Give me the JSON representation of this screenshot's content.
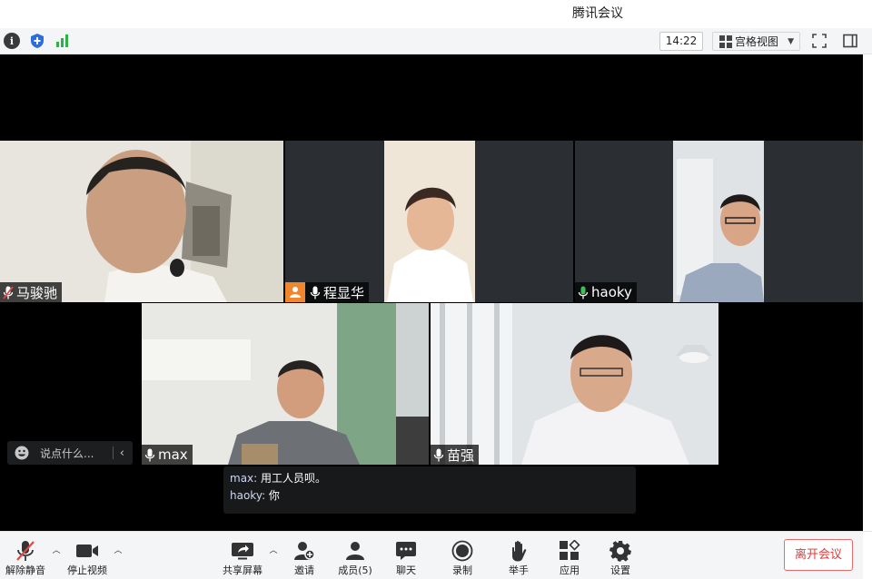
{
  "window": {
    "title": "腾讯会议"
  },
  "toolbar": {
    "clock": "14:22",
    "layout_label": "宫格视图",
    "icons": [
      "info-icon",
      "shield-icon",
      "signal-icon",
      "fullscreen-icon",
      "sidebar-toggle-icon"
    ]
  },
  "participants": [
    {
      "name": "马骏驰",
      "mic": "muted"
    },
    {
      "name": "程显华",
      "mic": "on",
      "role": "host"
    },
    {
      "name": "haoky",
      "mic": "speaking",
      "active": true
    },
    {
      "name": "max",
      "mic": "on"
    },
    {
      "name": "苗强",
      "mic": "on"
    }
  ],
  "chat_quick": {
    "placeholder": "说点什么..."
  },
  "chat": [
    {
      "sender": "max",
      "text": "用工人员呗。"
    },
    {
      "sender": "haoky",
      "text": "你"
    }
  ],
  "controls": {
    "unmute": "解除静音",
    "stop_video": "停止视频",
    "share_screen": "共享屏幕",
    "invite": "邀请",
    "members": "成员(5)",
    "chat": "聊天",
    "record": "录制",
    "raise_hand": "举手",
    "apps": "应用",
    "settings": "设置",
    "leave": "离开会议"
  },
  "colors": {
    "accent_green": "#3fbf5a",
    "host_orange": "#f0872e",
    "leave_red": "#e03b3b",
    "stage": "#000000",
    "tile_bg": "#2b2f33"
  }
}
